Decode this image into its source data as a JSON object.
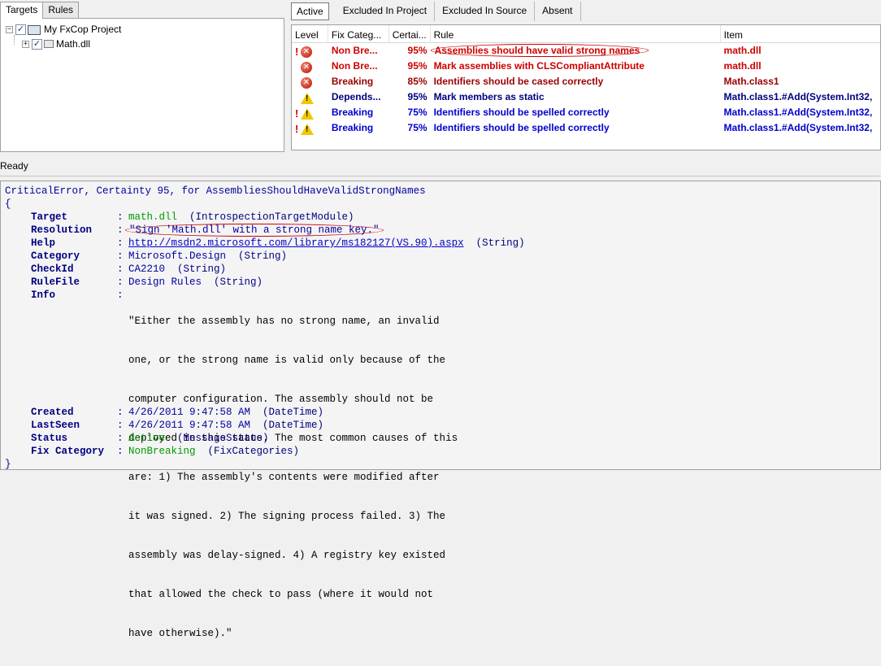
{
  "left_tabs": [
    "Targets",
    "Rules"
  ],
  "tree": {
    "project": "My FxCop Project",
    "child": "Math.dll",
    "expander_root": "−",
    "expander_child": "+",
    "check_mark": "✓"
  },
  "right_tabs": [
    "Active",
    "Excluded In Project",
    "Excluded In Source",
    "Absent"
  ],
  "grid": {
    "columns": [
      "Level",
      "Fix Categ...",
      "Certai...",
      "Rule",
      "Item"
    ],
    "rows": [
      {
        "excl": "!",
        "icon": "error",
        "fix": "Non Bre...",
        "cert": "95%",
        "rule": "Assemblies should have valid strong names",
        "item": "math.dll",
        "color": "red"
      },
      {
        "excl": "",
        "icon": "error",
        "fix": "Non Bre...",
        "cert": "95%",
        "rule": "Mark assemblies with CLSCompliantAttribute",
        "item": "math.dll",
        "color": "red"
      },
      {
        "excl": "",
        "icon": "error",
        "fix": "Breaking",
        "cert": "85%",
        "rule": "Identifiers should be cased correctly",
        "item": "Math.class1",
        "color": "darkred"
      },
      {
        "excl": "",
        "icon": "warning",
        "fix": "Depends...",
        "cert": "95%",
        "rule": "Mark members as static",
        "item": "Math.class1.#Add(System.Int32,",
        "color": "navy"
      },
      {
        "excl": "!",
        "icon": "warning",
        "fix": "Breaking",
        "cert": "75%",
        "rule": "Identifiers should be spelled correctly",
        "item": "Math.class1.#Add(System.Int32,",
        "color": "blue"
      },
      {
        "excl": "!",
        "icon": "warning",
        "fix": "Breaking",
        "cert": "75%",
        "rule": "Identifiers should be spelled correctly",
        "item": "Math.class1.#Add(System.Int32,",
        "color": "blue"
      }
    ]
  },
  "status": "Ready",
  "details": {
    "header": "CriticalError, Certainty 95, for ",
    "header_rule": "AssembliesShouldHaveValidStrongNames",
    "open_brace": "{",
    "close_brace": "}",
    "colon": ":",
    "target_key": "Target",
    "target_val": "math.dll",
    "target_type": "  (IntrospectionTargetModule)",
    "resolution_key": "Resolution",
    "resolution_val": "\"Sign 'Math.dll' with a strong name key.\"",
    "help_key": "Help",
    "help_val": "http://msdn2.microsoft.com/library/ms182127(VS.90).aspx",
    "help_type": "  (String)",
    "category_key": "Category",
    "category_val": "Microsoft.Design",
    "category_type": "  (String)",
    "checkid_key": "CheckId",
    "checkid_val": "CA2210",
    "checkid_type": "  (String)",
    "rulefile_key": "RuleFile",
    "rulefile_val": "Design Rules",
    "rulefile_type": "  (String)",
    "info_key": "Info",
    "info_lines": [
      "\"Either the assembly has no strong name, an invalid",
      "one, or the strong name is valid only because of the",
      "computer configuration. The assembly should not be",
      "deployed in this state. The most common causes of this",
      "are: 1) The assembly's contents were modified after",
      "it was signed. 2) The signing process failed. 3) The",
      "assembly was delay-signed. 4) A registry key existed",
      "that allowed the check to pass (where it would not",
      "have otherwise).\""
    ],
    "created_key": "Created",
    "created_val": "4/26/2011 9:47:58 AM",
    "created_type": "  (DateTime)",
    "lastseen_key": "LastSeen",
    "lastseen_val": "4/26/2011 9:47:58 AM",
    "lastseen_type": "  (DateTime)",
    "status_key": "Status",
    "status_val": "Active",
    "status_type": "  (MessageStatus)",
    "fixcat_key": "Fix Category",
    "fixcat_val": "NonBreaking",
    "fixcat_type": "  (FixCategories)"
  }
}
